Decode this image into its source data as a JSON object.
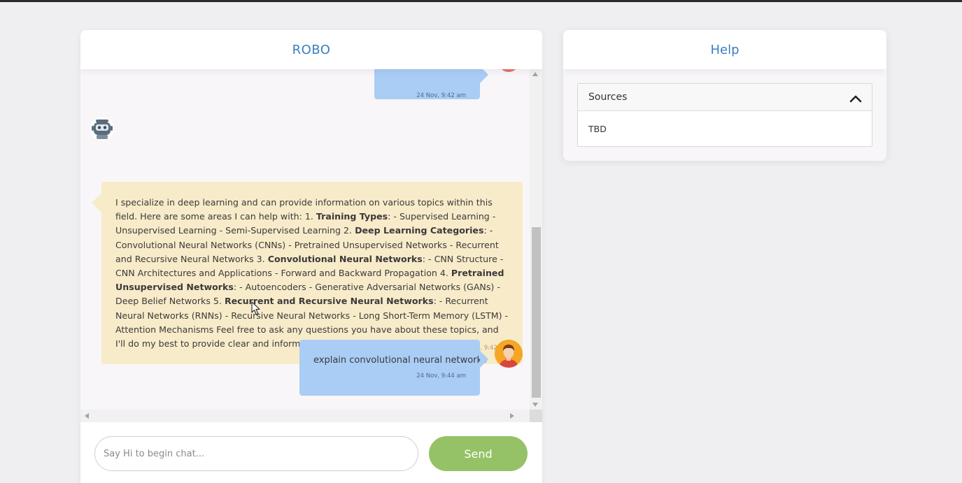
{
  "chat": {
    "title": "ROBO",
    "messages": [
      {
        "role": "user",
        "text": "",
        "time": "24 Nov, 9:42 am"
      },
      {
        "role": "bot",
        "segments": [
          {
            "t": "I specialize in deep learning and can provide information on various topics within this field. Here are some areas I can help with: 1. ",
            "b": false
          },
          {
            "t": "Training Types",
            "b": true
          },
          {
            "t": ": - Supervised Learning - Unsupervised Learning - Semi-Supervised Learning 2. ",
            "b": false
          },
          {
            "t": "Deep Learning Categories",
            "b": true
          },
          {
            "t": ": - Convolutional Neural Networks (CNNs) - Pretrained Unsupervised Networks - Recurrent and Recursive Neural Networks 3. ",
            "b": false
          },
          {
            "t": "Convolutional Neural Networks",
            "b": true
          },
          {
            "t": ": - CNN Structure - CNN Architectures and Applications - Forward and Backward Propagation 4. ",
            "b": false
          },
          {
            "t": "Pretrained Unsupervised Networks",
            "b": true
          },
          {
            "t": ": - Autoencoders - Generative Adversarial Networks (GANs) - Deep Belief Networks 5. ",
            "b": false
          },
          {
            "t": "Recurrent and Recursive Neural Networks",
            "b": true
          },
          {
            "t": ": - Recurrent Neural Networks (RNNs) - Recursive Neural Networks - Long Short-Term Memory (LSTM) - Attention Mechanisms Feel free to ask any questions you have about these topics, and I'll do my best to provide clear and informative answers!",
            "b": false
          }
        ],
        "time": "24 Nov, 9:42 am"
      },
      {
        "role": "user",
        "text": "explain convolutional neural networks",
        "time": "24 Nov, 9:44 am"
      }
    ],
    "input_placeholder": "Say Hi to begin chat...",
    "input_value": "",
    "send_label": "Send"
  },
  "help": {
    "title": "Help",
    "accordion": {
      "title": "Sources",
      "content": "TBD",
      "expanded": true
    }
  },
  "colors": {
    "accent_title": "#3a7fbf",
    "user_bubble": "#a9cdf5",
    "bot_bubble": "#f8ebc9",
    "send_button": "#95c266",
    "page_bg": "#efeff1"
  }
}
